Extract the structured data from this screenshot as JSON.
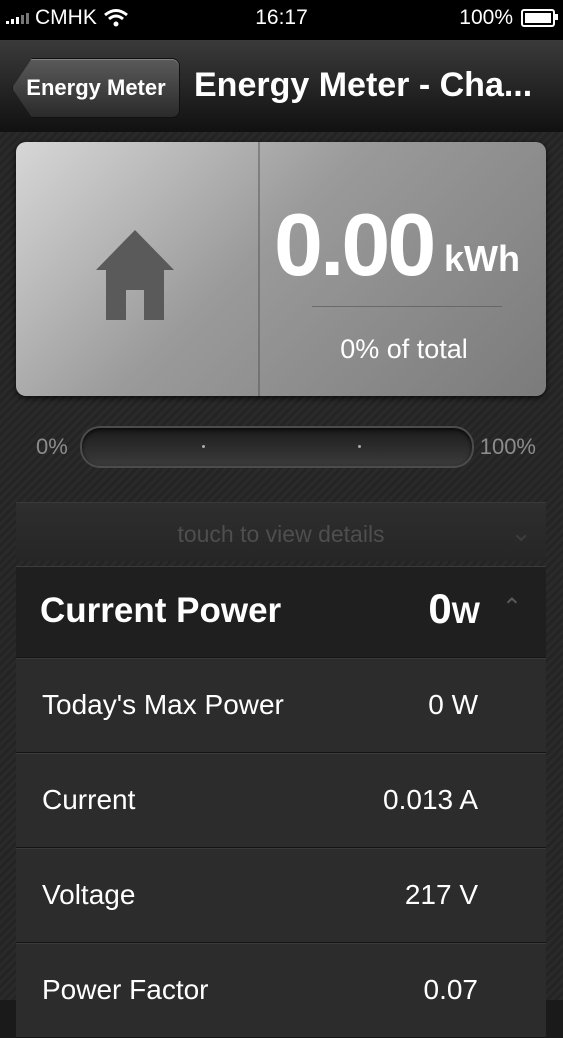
{
  "status_bar": {
    "carrier": "CMHK",
    "time": "16:17",
    "battery": "100%"
  },
  "nav": {
    "back_label": "Energy Meter",
    "title": "Energy Meter - Cha..."
  },
  "summary": {
    "kwh_value": "0.00",
    "kwh_unit": "kWh",
    "pct_of_total": "0% of total"
  },
  "progress": {
    "min_label": "0%",
    "max_label": "100%",
    "fill_fraction": 0
  },
  "details_hint": "touch to view details",
  "current_power": {
    "label": "Current Power",
    "value": "0",
    "unit": "W"
  },
  "metrics": [
    {
      "label": "Today's Max Power",
      "value": "0 W"
    },
    {
      "label": "Current",
      "value": "0.013 A"
    },
    {
      "label": "Voltage",
      "value": "217 V"
    },
    {
      "label": "Power Factor",
      "value": "0.07"
    }
  ],
  "icons": {
    "home": "house-icon",
    "expand": "chevron-down-icon",
    "collapse": "chevron-up-icon",
    "wifi": "wifi-icon",
    "battery": "battery-icon",
    "signal": "signal-icon"
  }
}
